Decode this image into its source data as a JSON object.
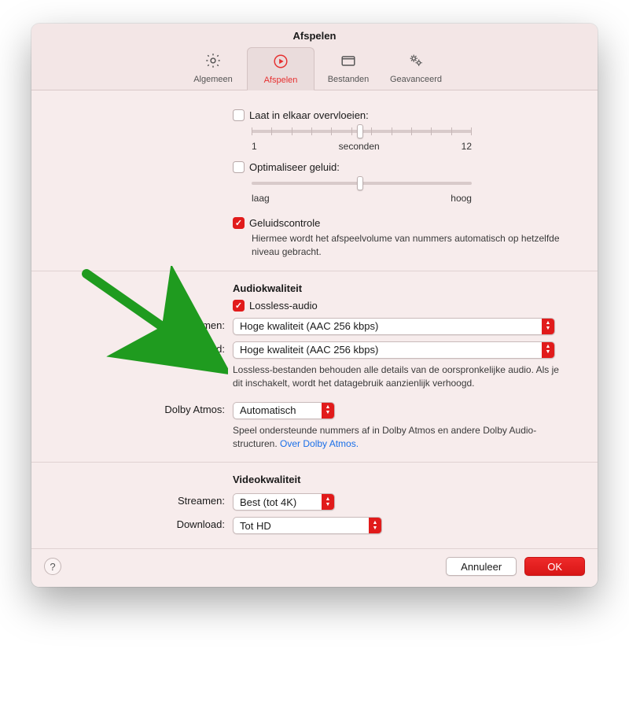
{
  "header": {
    "title": "Afspelen",
    "tabs": [
      {
        "label": "Algemeen"
      },
      {
        "label": "Afspelen"
      },
      {
        "label": "Bestanden"
      },
      {
        "label": "Geavanceerd"
      }
    ]
  },
  "crossfade": {
    "label": "Laat in elkaar overvloeien:",
    "min": "1",
    "mid": "seconden",
    "max": "12"
  },
  "optimize": {
    "label": "Optimaliseer geluid:",
    "min": "laag",
    "max": "hoog"
  },
  "soundcheck": {
    "label": "Geluidscontrole",
    "desc": "Hiermee wordt het afspeelvolume van nummers automatisch op hetzelfde niveau gebracht."
  },
  "audio": {
    "heading": "Audiokwaliteit",
    "lossless_label": "Lossless-audio",
    "stream_label": "Streamen:",
    "stream_value": "Hoge kwaliteit (AAC 256 kbps)",
    "download_label": "Download:",
    "download_value": "Hoge kwaliteit (AAC 256 kbps)",
    "note": "Lossless-bestanden behouden alle details van de oorspronkelijke audio. Als je dit inschakelt, wordt het datagebruik aanzienlijk verhoogd."
  },
  "dolby": {
    "label": "Dolby Atmos:",
    "value": "Automatisch",
    "note_pre": "Speel ondersteunde nummers af in Dolby Atmos en andere Dolby Audio-structuren. ",
    "link": "Over Dolby Atmos."
  },
  "video": {
    "heading": "Videokwaliteit",
    "stream_label": "Streamen:",
    "stream_value": "Best (tot 4K)",
    "download_label": "Download:",
    "download_value": "Tot HD"
  },
  "footer": {
    "cancel": "Annuleer",
    "ok": "OK"
  }
}
